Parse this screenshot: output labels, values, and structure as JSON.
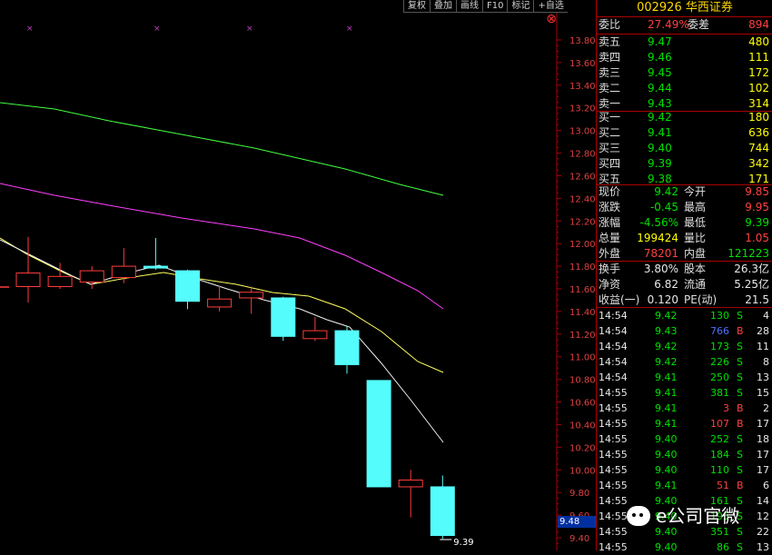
{
  "toolbar": [
    "复权",
    "叠加",
    "画线",
    "F10",
    "标记",
    "+自选"
  ],
  "price_axis": [
    "13.80",
    "13.60",
    "13.40",
    "13.20",
    "13.00",
    "12.80",
    "12.60",
    "12.40",
    "12.20",
    "12.00",
    "11.80",
    "11.60",
    "11.40",
    "11.20",
    "11.00",
    "10.80",
    "10.60",
    "10.40",
    "10.20",
    "10.00",
    "9.80",
    "9.60",
    "9.40"
  ],
  "current_price_tag": "9.48",
  "low_marker": "9.39",
  "colors": {
    "up": "#ff3c3c",
    "down": "#54fcfc",
    "ma5": "#ffffff",
    "ma10": "#ffff60",
    "ma20": "#ff40ff",
    "ma60": "#40ff40",
    "bg": "#000000"
  },
  "stock": {
    "code": "002926",
    "name": "华西证券"
  },
  "weibi": {
    "label": "委比",
    "value": "27.49%",
    "diff_label": "委差",
    "diff": "894"
  },
  "asks": [
    {
      "label": "卖五",
      "price": "9.47",
      "vol": "480"
    },
    {
      "label": "卖四",
      "price": "9.46",
      "vol": "111"
    },
    {
      "label": "卖三",
      "price": "9.45",
      "vol": "172"
    },
    {
      "label": "卖二",
      "price": "9.44",
      "vol": "102"
    },
    {
      "label": "卖一",
      "price": "9.43",
      "vol": "314"
    }
  ],
  "bids": [
    {
      "label": "买一",
      "price": "9.42",
      "vol": "180"
    },
    {
      "label": "买二",
      "price": "9.41",
      "vol": "636"
    },
    {
      "label": "买三",
      "price": "9.40",
      "vol": "744"
    },
    {
      "label": "买四",
      "price": "9.39",
      "vol": "342"
    },
    {
      "label": "买五",
      "price": "9.38",
      "vol": "171"
    }
  ],
  "quote": [
    {
      "l1": "现价",
      "v1": "9.42",
      "l2": "今开",
      "v2": "9.85"
    },
    {
      "l1": "涨跌",
      "v1": "-0.45",
      "l2": "最高",
      "v2": "9.95"
    },
    {
      "l1": "涨幅",
      "v1": "-4.56%",
      "l2": "最低",
      "v2": "9.39"
    },
    {
      "l1": "总量",
      "v1": "199424",
      "l2": "量比",
      "v2": "1.05"
    },
    {
      "l1": "外盘",
      "v1": "78201",
      "l2": "内盘",
      "v2": "121223"
    }
  ],
  "stats": [
    {
      "l1": "换手",
      "v1": "3.80%",
      "l2": "股本",
      "v2": "26.3亿"
    },
    {
      "l1": "净资",
      "v1": "6.82",
      "l2": "流通",
      "v2": "5.25亿"
    },
    {
      "l1": "收益(一)",
      "v1": "0.120",
      "l2": "PE(动)",
      "v2": "21.5"
    }
  ],
  "ticks": [
    {
      "t": "14:54",
      "p": "9.42",
      "v": "130",
      "s": "S",
      "n": "4"
    },
    {
      "t": "14:54",
      "p": "9.43",
      "v": "766",
      "s": "B",
      "n": "28"
    },
    {
      "t": "14:54",
      "p": "9.42",
      "v": "173",
      "s": "S",
      "n": "11"
    },
    {
      "t": "14:54",
      "p": "9.42",
      "v": "226",
      "s": "S",
      "n": "8"
    },
    {
      "t": "14:54",
      "p": "9.41",
      "v": "250",
      "s": "S",
      "n": "13"
    },
    {
      "t": "14:55",
      "p": "9.41",
      "v": "381",
      "s": "S",
      "n": "15"
    },
    {
      "t": "14:55",
      "p": "9.41",
      "v": "3",
      "s": "B",
      "n": "2"
    },
    {
      "t": "14:55",
      "p": "9.41",
      "v": "107",
      "s": "B",
      "n": "17"
    },
    {
      "t": "14:55",
      "p": "9.40",
      "v": "252",
      "s": "S",
      "n": "18"
    },
    {
      "t": "14:55",
      "p": "9.40",
      "v": "184",
      "s": "S",
      "n": "17"
    },
    {
      "t": "14:55",
      "p": "9.40",
      "v": "110",
      "s": "S",
      "n": "17"
    },
    {
      "t": "14:55",
      "p": "9.41",
      "v": "51",
      "s": "B",
      "n": "6"
    },
    {
      "t": "14:55",
      "p": "9.40",
      "v": "161",
      "s": "S",
      "n": "14"
    },
    {
      "t": "14:55",
      "p": "9.40",
      "v": "195",
      "s": "S",
      "n": "12"
    },
    {
      "t": "14:55",
      "p": "9.40",
      "v": "351",
      "s": "S",
      "n": "22"
    },
    {
      "t": "14:55",
      "p": "9.40",
      "v": "86",
      "s": "S",
      "n": "13"
    },
    {
      "t": "14:55",
      "p": "9.40",
      "v": "115",
      "s": "S",
      "n": "13"
    }
  ],
  "watermark": "e公司官微",
  "candles": [
    {
      "o": 11.62,
      "c": 11.74,
      "h": 12.06,
      "l": 11.48
    },
    {
      "o": 11.62,
      "c": 11.71,
      "h": 11.83,
      "l": 11.6
    },
    {
      "o": 11.66,
      "c": 11.76,
      "h": 11.8,
      "l": 11.6
    },
    {
      "o": 11.7,
      "c": 11.8,
      "h": 11.96,
      "l": 11.65
    },
    {
      "o": 11.8,
      "c": 11.79,
      "h": 12.05,
      "l": 11.77
    },
    {
      "o": 11.76,
      "c": 11.49,
      "h": 11.77,
      "l": 11.42
    },
    {
      "o": 11.44,
      "c": 11.51,
      "h": 11.63,
      "l": 11.4
    },
    {
      "o": 11.52,
      "c": 11.57,
      "h": 11.62,
      "l": 11.38
    },
    {
      "o": 11.52,
      "c": 11.18,
      "h": 11.53,
      "l": 11.14
    },
    {
      "o": 11.16,
      "c": 11.23,
      "h": 11.35,
      "l": 11.14
    },
    {
      "o": 11.23,
      "c": 10.93,
      "h": 11.27,
      "l": 10.85
    },
    {
      "o": 10.79,
      "c": 9.85,
      "h": 10.79,
      "l": 9.85
    },
    {
      "o": 9.85,
      "c": 9.91,
      "h": 10.0,
      "l": 9.58
    },
    {
      "o": 9.85,
      "c": 9.42,
      "h": 9.95,
      "l": 9.39
    }
  ]
}
